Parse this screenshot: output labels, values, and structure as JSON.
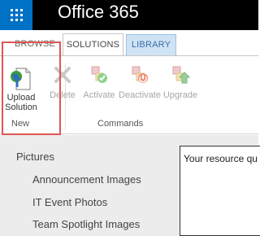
{
  "suite": {
    "title": "Office 365",
    "waffle_icon": "app-launcher-icon",
    "brand_color": "#0072c6"
  },
  "ribbon": {
    "tabs": [
      {
        "label": "BROWSE"
      },
      {
        "label": "SOLUTIONS"
      },
      {
        "label": "LIBRARY"
      }
    ],
    "groups": {
      "new": {
        "label": "New",
        "buttons": [
          {
            "label_line1": "Upload",
            "label_line2": "Solution",
            "icon": "upload-solution-icon"
          }
        ]
      },
      "commands": {
        "label": "Commands",
        "buttons": [
          {
            "label": "Delete",
            "icon": "delete-icon"
          },
          {
            "label": "Activate",
            "icon": "activate-icon"
          },
          {
            "label": "Deactivate",
            "icon": "deactivate-icon"
          },
          {
            "label": "Upgrade",
            "icon": "upgrade-icon"
          }
        ]
      }
    },
    "highlight_color": "#e05555"
  },
  "nav": {
    "items": [
      {
        "label": "Pictures"
      },
      {
        "label": "Announcement Images"
      },
      {
        "label": "IT Event Photos"
      },
      {
        "label": "Team Spotlight Images"
      }
    ]
  },
  "resource": {
    "text": "Your resource qu"
  }
}
